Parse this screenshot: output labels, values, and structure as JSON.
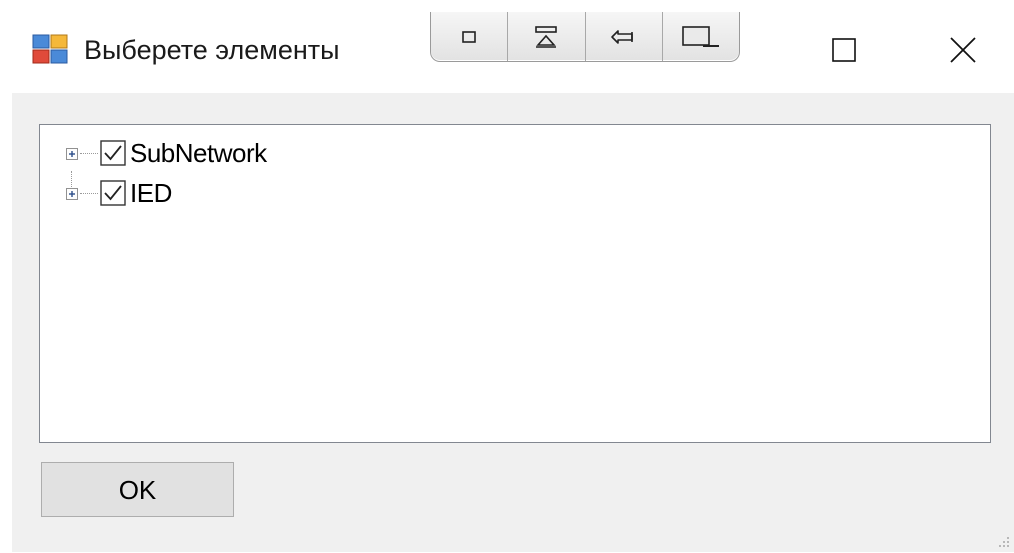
{
  "window": {
    "title": "Выберете элементы"
  },
  "title_bar": {
    "icon": "app-form-icon",
    "snap_layout_icons": [
      "restore-small-icon",
      "dock-top-icon",
      "pin-icon",
      "dock-bottom-icon"
    ],
    "controls": [
      "maximize-icon",
      "close-icon"
    ]
  },
  "tree": {
    "nodes": [
      {
        "label": "SubNetwork",
        "checked": true,
        "expanded": false,
        "expander_icon": "plus-box-icon"
      },
      {
        "label": "IED",
        "checked": true,
        "expanded": false,
        "expander_icon": "plus-box-icon"
      }
    ]
  },
  "buttons": {
    "ok_label": "OK"
  },
  "colors": {
    "client_background": "#f0f0f0",
    "button_background": "#e1e1e1",
    "tree_border": "#828790"
  }
}
